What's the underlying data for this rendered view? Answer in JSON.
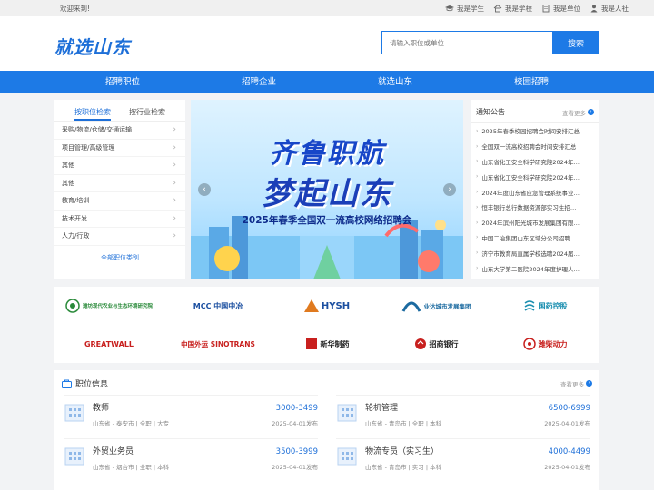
{
  "topbar": {
    "welcome": "欢迎来到!",
    "links": [
      {
        "label": "我是学生",
        "icon": "graduation-cap-icon"
      },
      {
        "label": "我是学校",
        "icon": "school-icon"
      },
      {
        "label": "我是单位",
        "icon": "building-icon"
      },
      {
        "label": "我是人社",
        "icon": "person-icon"
      }
    ]
  },
  "header": {
    "logo": "就选山东",
    "search_placeholder": "请输入职位或单位",
    "search_button": "搜索"
  },
  "nav": [
    "招聘职位",
    "招聘企业",
    "就选山东",
    "校园招聘"
  ],
  "left": {
    "tabs": [
      "按职位检索",
      "按行业检索"
    ],
    "categories": [
      "采购/物流/仓储/交通运输",
      "项目管理/高级管理",
      "其他",
      "其他",
      "教育/培训",
      "技术开发",
      "人力/行政"
    ],
    "all_label": "全部职位类别"
  },
  "banner": {
    "title1": "齐鲁职航",
    "title2": "梦起山东",
    "subtitle": "2025年春季全国双一流高校网络招聘会"
  },
  "notice": {
    "title": "通知公告",
    "more": "查看更多",
    "items": [
      "2025年春季校园招聘会时间安排汇总",
      "全国双一流高校招聘会时间安排汇总",
      "山东省化工安全科学研究院2024年…",
      "山东省化工安全科学研究院2024年…",
      "2024年度山东省应急管理系统事业…",
      "恒丰银行总行数据资源部实习生招…",
      "2024年滨州阳光城市发展集团有限…",
      "中国二冶集团山东区域分公司招聘…",
      "济宁市教育局直属学校选聘2024届…",
      "山东大学第二医院2024年度护理人…"
    ]
  },
  "logos": [
    {
      "name": "潍坊现代农业与生态环境研究院",
      "color": "#2a8a3a"
    },
    {
      "name": "MCC 中国中冶",
      "color": "#1b4fa0"
    },
    {
      "name": "HYSH",
      "color": "#1b4fa0"
    },
    {
      "name": "业达城市发展集团",
      "color": "#1b6aa0"
    },
    {
      "name": "国药控股",
      "color": "#1b8fb0"
    },
    {
      "name": "GREATWALL",
      "color": "#c8201e"
    },
    {
      "name": "中国外运 SINOTRANS",
      "color": "#c8201e"
    },
    {
      "name": "新华制药",
      "color": "#222222"
    },
    {
      "name": "招商银行",
      "color": "#222222"
    },
    {
      "name": "潍柴动力",
      "color": "#c8201e"
    }
  ],
  "jobs": {
    "title": "职位信息",
    "more": "查看更多",
    "items": [
      {
        "name": "教师",
        "salary": "3000-3499",
        "meta": "山东省 - 泰安市 | 全职 | 大专",
        "date": "2025-04-01发布"
      },
      {
        "name": "轮机管理",
        "salary": "6500-6999",
        "meta": "山东省 - 青岛市 | 全职 | 本科",
        "date": "2025-04-01发布"
      },
      {
        "name": "外贸业务员",
        "salary": "3500-3999",
        "meta": "山东省 - 烟台市 | 全职 | 本科",
        "date": "2025-04-01发布"
      },
      {
        "name": "物流专员（实习生）",
        "salary": "4000-4499",
        "meta": "山东省 - 青岛市 | 实习 | 本科",
        "date": "2025-04-01发布"
      }
    ]
  }
}
